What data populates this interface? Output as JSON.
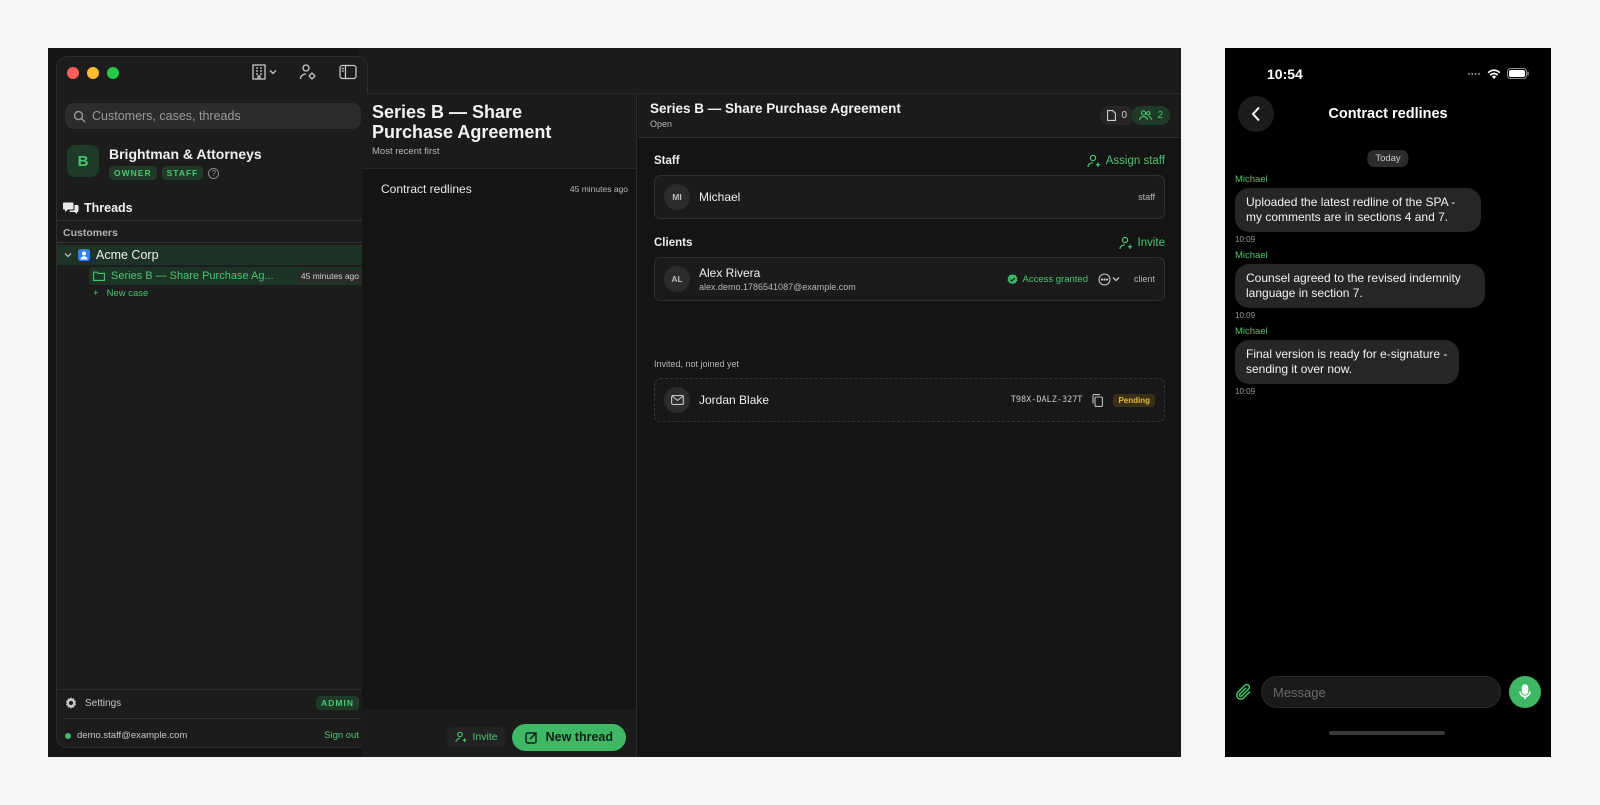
{
  "desktop": {
    "sidebar": {
      "search_placeholder": "Customers, cases, threads",
      "org": {
        "initial": "B",
        "name": "Brightman & Attorneys",
        "badges": [
          "OWNER",
          "STAFF"
        ],
        "help": "?"
      },
      "threads_label": "Threads",
      "customers_label": "Customers",
      "customer": {
        "name": "Acme Corp"
      },
      "case": {
        "label": "Series B — Share Purchase Ag...",
        "time": "45 minutes ago"
      },
      "new_case_label": "New case",
      "settings_label": "Settings",
      "settings_badge": "ADMIN",
      "account_email": "demo.staff@example.com",
      "sign_out_label": "Sign out"
    },
    "middle": {
      "title": "Series B — Share Purchase Agreement",
      "subtitle": "Most recent first",
      "threads": [
        {
          "title": "Contract redlines",
          "time": "45 minutes ago"
        }
      ],
      "invite_label": "Invite",
      "new_thread_label": "New thread"
    },
    "detail": {
      "title": "Series B — Share Purchase Agreement",
      "status": "Open",
      "docs_count": "0",
      "people_count": "2",
      "staff_label": "Staff",
      "assign_staff_label": "Assign staff",
      "staff": [
        {
          "initials": "MI",
          "name": "Michael",
          "role": "staff"
        }
      ],
      "clients_label": "Clients",
      "invite_label": "Invite",
      "clients": [
        {
          "initials": "AL",
          "name": "Alex Rivera",
          "email": "alex.demo.1786541087@example.com",
          "access": "Access granted",
          "role": "client"
        }
      ],
      "invited_label": "Invited, not joined yet",
      "invited": [
        {
          "name": "Jordan Blake",
          "code": "T98X-DALZ-327T",
          "status": "Pending"
        }
      ]
    }
  },
  "phone": {
    "time": "10:54",
    "title": "Contract redlines",
    "day_divider": "Today",
    "messages": [
      {
        "sender": "Michael",
        "text": "Uploaded the latest redline of the SPA - my comments are in sections 4 and 7.",
        "time": "10:09"
      },
      {
        "sender": "Michael",
        "text": "Counsel agreed to the revised indemnity language in section 7.",
        "time": "10:09"
      },
      {
        "sender": "Michael",
        "text": "Final version is ready for e-signature - sending it over now.",
        "time": "10:09"
      }
    ],
    "input_placeholder": "Message"
  },
  "colors": {
    "accent": "#3fb866",
    "accent_text": "#4cc472",
    "pending": "#e3b93a"
  },
  "icons": [
    "search-icon",
    "building-icon",
    "person-gear-icon",
    "sidebar-toggle-icon",
    "threads-icon",
    "chevron-down-icon",
    "person-icon",
    "folder-icon",
    "plus-icon",
    "gear-icon",
    "doc-icon",
    "people-icon",
    "person-add-icon",
    "check-circle-icon",
    "more-icon",
    "mail-icon",
    "copy-icon",
    "compose-icon",
    "back-icon",
    "wifi-icon",
    "battery-icon",
    "paperclip-icon",
    "mic-icon"
  ]
}
